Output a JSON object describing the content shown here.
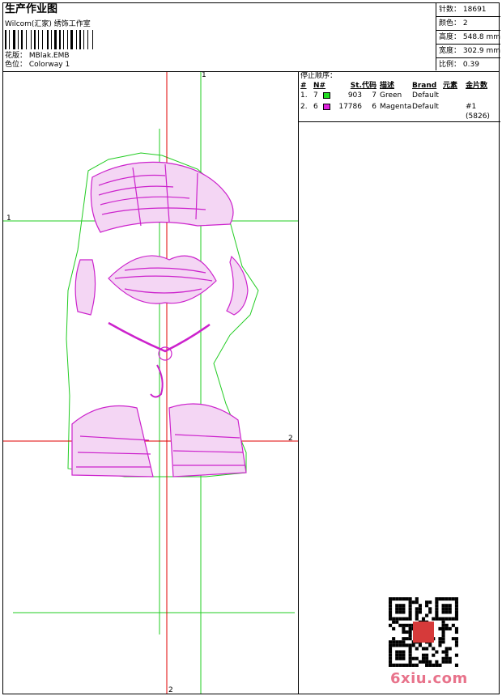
{
  "header": {
    "title": "生产作业图",
    "software": "Wilcom(汇家) 绣饰工作室",
    "design_label": "花版：",
    "design_value": "MBlak.EMB",
    "colorway_label": "色位：",
    "colorway_value": "Colorway 1"
  },
  "stats": [
    {
      "label": "针数：",
      "value": "18691"
    },
    {
      "label": "颜色：",
      "value": "2"
    },
    {
      "label": "高度：",
      "value": "548.8 mm"
    },
    {
      "label": "宽度：",
      "value": "302.9 mm"
    },
    {
      "label": "比例：",
      "value": "0.39"
    }
  ],
  "table": {
    "title": "停止顺序：",
    "headers": {
      "idx": "#",
      "n": "N#",
      "st": "St.",
      "code": "代码",
      "desc": "描述",
      "brand": "Brand",
      "type": "元素",
      "seq": "金片数"
    },
    "rows": [
      {
        "idx": "1.",
        "n": "7",
        "color": "#22dd22",
        "st": "903",
        "code": "7",
        "desc": "Green",
        "brand": "Default",
        "type": "",
        "seq": ""
      },
      {
        "idx": "2.",
        "n": "6",
        "color": "#dd22dd",
        "st": "17786",
        "code": "6",
        "desc": "Magenta",
        "brand": "Default",
        "type": "",
        "seq": "#1 (5826)"
      }
    ]
  },
  "guides": {
    "top_marker": "1",
    "left_marker": "1",
    "right_marker": "2",
    "bottom_marker": "2"
  },
  "colors": {
    "green_line": "#22cc22",
    "red_line": "#e00000",
    "stitch": "#cc22cc"
  },
  "watermark": "6xiu.com"
}
